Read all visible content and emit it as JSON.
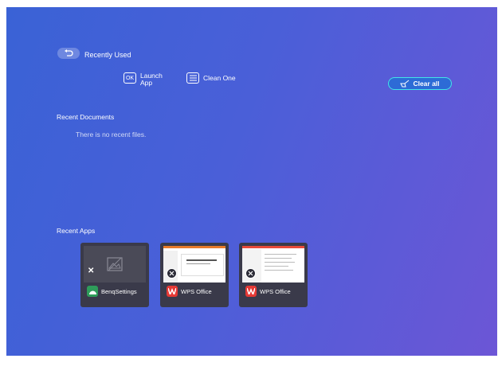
{
  "header": {
    "title": "Recently Used"
  },
  "hints": [
    {
      "key": "OK",
      "label": "Launch App"
    },
    {
      "key": "menu",
      "label": "Clean One"
    }
  ],
  "clear_all": {
    "label": "Clear all"
  },
  "documents": {
    "title": "Recent Documents",
    "empty_message": "There is no recent files."
  },
  "apps": {
    "title": "Recent Apps",
    "cards": [
      {
        "name": "BenqSettings",
        "icon": "android-icon"
      },
      {
        "name": "WPS Office",
        "icon": "wps-office-icon"
      },
      {
        "name": "WPS Office",
        "icon": "wps-office-icon"
      }
    ]
  },
  "colors": {
    "accent_border": "#43e3e8",
    "wps_red": "#e53935",
    "benq_green": "#2e9c5a"
  }
}
